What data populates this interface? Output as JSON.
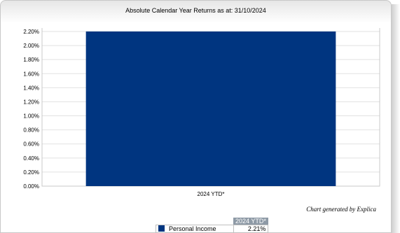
{
  "chart_data": {
    "type": "bar",
    "title": "Absolute Calendar Year Returns as at: 31/10/2024",
    "categories": [
      "2024 YTD*"
    ],
    "series": [
      {
        "name": "Personal Income",
        "values": [
          2.21
        ],
        "color": "#003580"
      }
    ],
    "ylim": [
      0,
      2.2
    ],
    "yticks": [
      "0.00%",
      "0.20%",
      "0.40%",
      "0.60%",
      "0.80%",
      "1.00%",
      "1.20%",
      "1.40%",
      "1.60%",
      "1.80%",
      "2.00%",
      "2.20%"
    ],
    "grid": true,
    "xlabel": "",
    "ylabel": ""
  },
  "credit": "Chart generated by Explica",
  "table": {
    "header": "2024 YTD*",
    "row_name": "Personal Income",
    "row_value": "2.21%"
  }
}
